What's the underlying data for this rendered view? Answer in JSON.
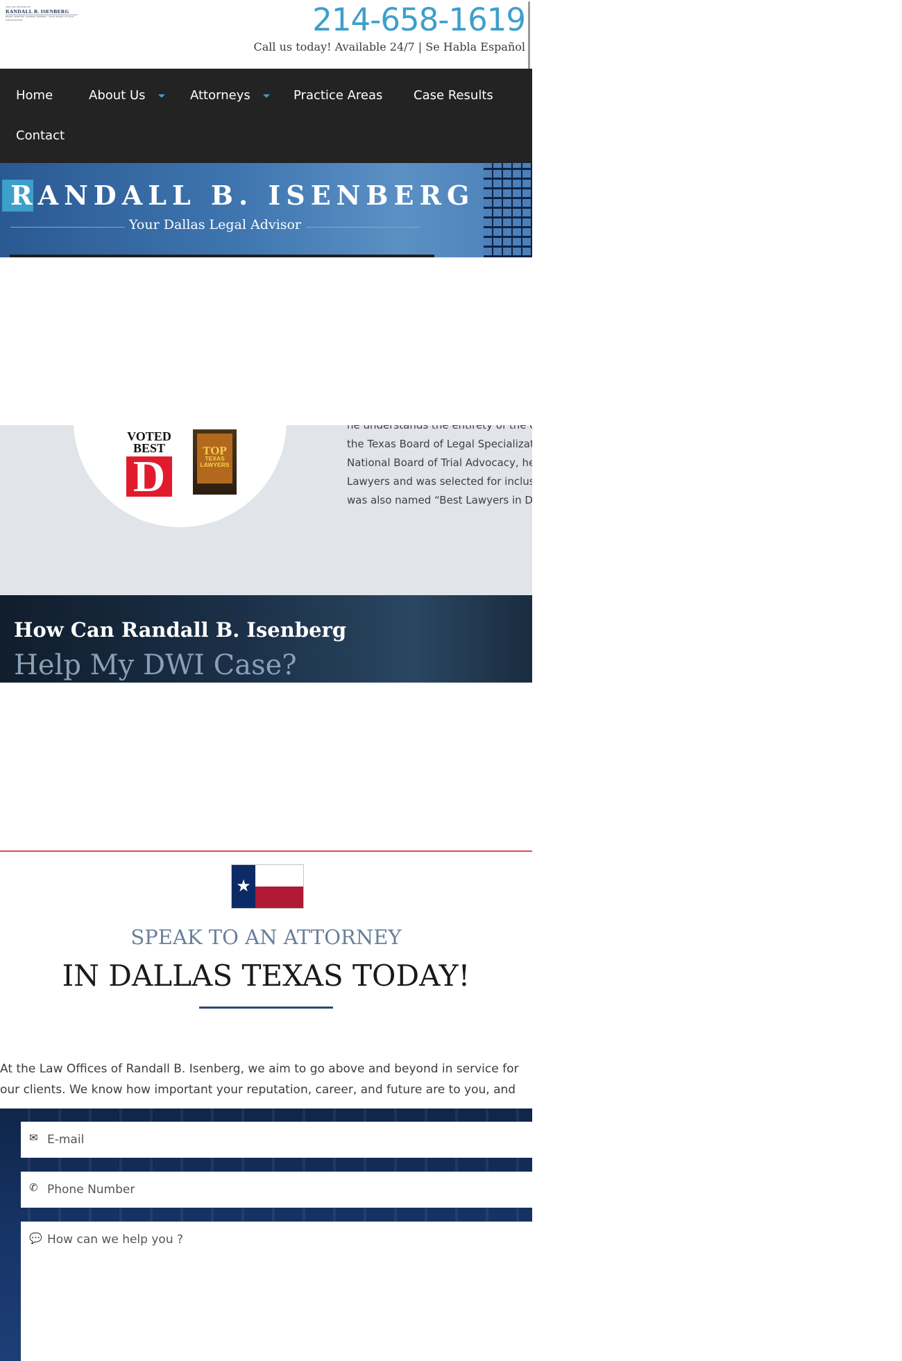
{
  "header": {
    "logo_top": "THE LAW OFFICES OF",
    "logo_name": "RANDALL B. ISENBERG",
    "logo_sub": "BOARD CERTIFIED, CRIMINAL DEFENSE • TEXAS BOARD OF LEGAL SPECIALIZATION",
    "phone": "214-658-1619",
    "tagline": "Call us today! Available 24/7 | Se Habla Español"
  },
  "nav": {
    "items": [
      {
        "label": "Home"
      },
      {
        "label": "About Us"
      },
      {
        "label": "Attorneys"
      },
      {
        "label": "Practice Areas"
      },
      {
        "label": "Case Results"
      },
      {
        "label": "Contact"
      }
    ]
  },
  "hero": {
    "title": "RANDALL B. ISENBERG",
    "subtitle": "Your Dallas Legal Advisor"
  },
  "awards": {
    "voted": "VOTED BEST",
    "d_logo": "D",
    "plaque_top": "TOP",
    "plaque_sub": "TEXAS LAWYERS",
    "bio_lines": [
      "he understands the entirety of the cr",
      "the Texas Board of Legal Specializati",
      "National Board of Trial Advocacy, he",
      "Lawyers and was selected for inclusi",
      "was also named “Best Lawyers in Dal"
    ]
  },
  "dwi": {
    "line1": "How Can Randall B. Isenberg",
    "line2": "Help My DWI Case?"
  },
  "speak": {
    "flag_star": "★",
    "line1": "SPEAK TO AN ATTORNEY",
    "line2": "IN DALLAS TEXAS TODAY!",
    "intro": "At the Law Offices of Randall B. Isenberg, we aim to go above and beyond in service for our clients. We know how important your reputation, career, and future are to you, and how"
  },
  "form": {
    "email_icon": "envelope-icon",
    "email_placeholder": "E-mail",
    "phone_icon": "phone-icon",
    "phone_placeholder": "Phone Number",
    "message_icon": "chat-icon",
    "message_placeholder": "How can we help you ?"
  },
  "colors": {
    "accent": "#3d9fcb",
    "nav_bg": "#232323",
    "awards_bg": "#e1e5ea",
    "divider_red": "#d9534f"
  }
}
